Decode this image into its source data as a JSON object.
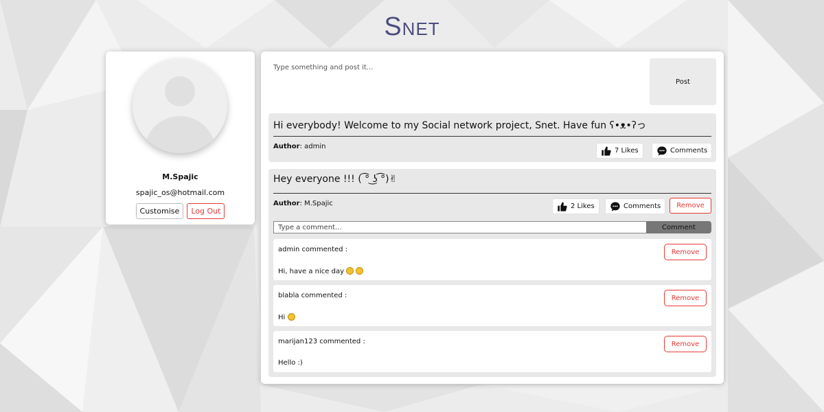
{
  "app": {
    "title": "Snet",
    "title_initial": "S",
    "title_rest": "NET"
  },
  "profile": {
    "name": "M.Spajic",
    "email": "spajic_os@hotmail.com",
    "customise_label": "Customise",
    "logout_label": "Log Out"
  },
  "composer": {
    "placeholder": "Type something and post it...",
    "post_label": "Post"
  },
  "posts": [
    {
      "text": "Hi everybody! Welcome to my Social network project, Snet. Have fun ʕ•ᴥ•ʔっ",
      "author_label": "Author",
      "author": ": admin",
      "likes": "7 Likes",
      "comments_label": "Comments"
    },
    {
      "text": "Hey everyone !!! ( ͡° ͜ʖ ͡°)✌",
      "author_label": "Author",
      "author": ": M.Spajic",
      "likes": "2 Likes",
      "comments_label": "Comments",
      "remove_label": "Remove",
      "comment_placeholder": "Type a comment...",
      "comment_button": "Comment",
      "comments": [
        {
          "who": "admin commented :",
          "text": "Hi, have a nice day",
          "remove_label": "Remove"
        },
        {
          "who": "blabla commented :",
          "text": "Hi",
          "remove_label": "Remove"
        },
        {
          "who": "marijan123 commented :",
          "text": "Hello :)",
          "remove_label": "Remove"
        }
      ]
    }
  ],
  "colors": {
    "accent": "#4d4e7e",
    "danger": "#e53935"
  }
}
